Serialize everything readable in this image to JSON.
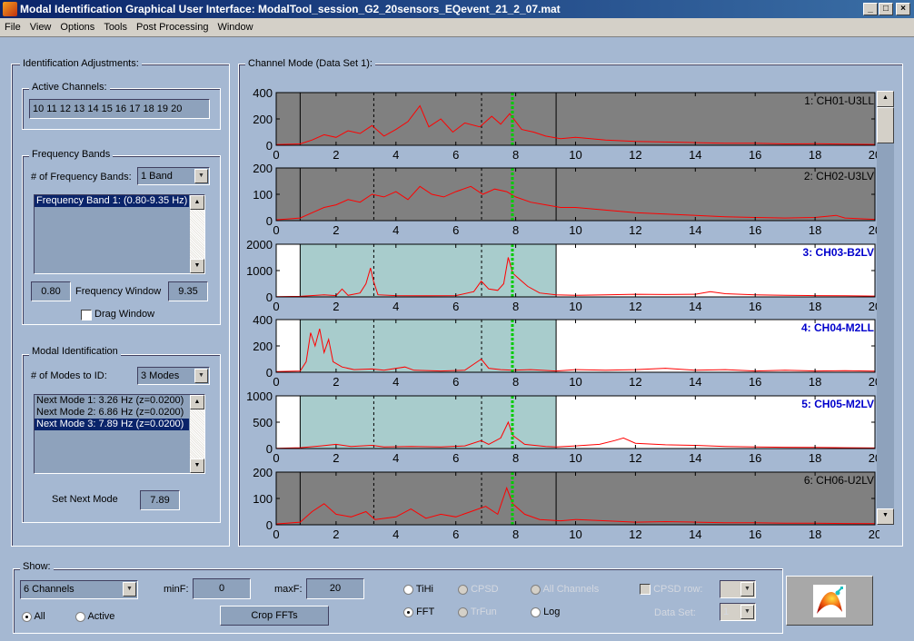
{
  "window": {
    "title": "Modal Identification Graphical User Interface: ModalTool_session_G2_20sensors_EQevent_21_2_07.mat",
    "buttons": [
      "_",
      "□",
      "×"
    ]
  },
  "menu": [
    "File",
    "View",
    "Options",
    "Tools",
    "Post Processing",
    "Window"
  ],
  "left_panel": {
    "title": "Identification Adjustments:",
    "active_channels": {
      "label": "Active Channels:",
      "value": "10 11 12 13 14 15 16 17 18 19 20"
    },
    "frequency_bands": {
      "label": "Frequency Bands",
      "count_label": "# of Frequency Bands:",
      "count_value": "1 Band",
      "items": [
        "Frequency Band 1: (0.80-9.35 Hz)"
      ],
      "selected": 0,
      "min": "0.80",
      "window_label": "Frequency Window",
      "max": "9.35",
      "drag_label": "Drag Window",
      "drag_checked": false
    },
    "modal_identification": {
      "label": "Modal Identification",
      "modes_label": "# of Modes to ID:",
      "modes_value": "3 Modes",
      "items": [
        "Next Mode 1: 3.26 Hz (z=0.0200)",
        "Next Mode 2: 6.86 Hz (z=0.0200)",
        "Next Mode 3: 7.89 Hz (z=0.0200)"
      ],
      "selected": 2,
      "set_label": "Set Next Mode",
      "set_value": "7.89"
    }
  },
  "channel_panel": {
    "title": "Channel Mode (Data Set 1):"
  },
  "show": {
    "label": "Show:",
    "channels_value": "6 Channels",
    "all_label": "All",
    "active_label": "Active",
    "view_all": true,
    "minF_label": "minF:",
    "minF": "0",
    "maxF_label": "maxF:",
    "maxF": "20",
    "crop_label": "Crop FFTs",
    "radios": {
      "tihi": "TiHi",
      "fft": "FFT",
      "cpsd": "CPSD",
      "trfun": "TrFun",
      "all_channels": "All Channels",
      "log": "Log"
    },
    "selected_mode": "FFT",
    "cpsd_row_label": "CPSD row:",
    "cpsd_row_value": "",
    "data_set_label": "Data Set:",
    "data_set_value": "1"
  },
  "icon_button": "surface-plot-icon",
  "chart_data": {
    "type": "line",
    "xlim": [
      0,
      20
    ],
    "xticks": [
      0,
      2,
      4,
      6,
      8,
      10,
      12,
      14,
      16,
      18,
      20
    ],
    "band": [
      0.8,
      9.35
    ],
    "mode_lines": [
      3.26,
      6.86
    ],
    "current_mode": 7.89,
    "colors": {
      "line": "#ff0000",
      "inactive_bg": "#808080",
      "active_bg": "#ffffff",
      "band": "#a8cccc",
      "current": "#00cc00",
      "active_title": "#0000cc"
    },
    "channels": [
      {
        "title": "1: CH01-U3LL",
        "active": false,
        "ylim": [
          0,
          400
        ],
        "yticks": [
          0,
          200,
          400
        ],
        "points": [
          [
            0,
            5
          ],
          [
            0.8,
            10
          ],
          [
            1.2,
            40
          ],
          [
            1.6,
            80
          ],
          [
            2,
            60
          ],
          [
            2.4,
            110
          ],
          [
            2.8,
            90
          ],
          [
            3.2,
            150
          ],
          [
            3.6,
            70
          ],
          [
            4,
            120
          ],
          [
            4.4,
            180
          ],
          [
            4.8,
            300
          ],
          [
            5.1,
            140
          ],
          [
            5.5,
            200
          ],
          [
            5.9,
            100
          ],
          [
            6.3,
            170
          ],
          [
            6.8,
            140
          ],
          [
            7.2,
            220
          ],
          [
            7.5,
            160
          ],
          [
            7.8,
            240
          ],
          [
            8.2,
            120
          ],
          [
            8.6,
            100
          ],
          [
            9,
            70
          ],
          [
            9.5,
            50
          ],
          [
            10,
            60
          ],
          [
            11,
            40
          ],
          [
            12,
            30
          ],
          [
            13,
            25
          ],
          [
            14,
            20
          ],
          [
            15,
            15
          ],
          [
            16,
            15
          ],
          [
            17,
            10
          ],
          [
            18,
            12
          ],
          [
            19,
            8
          ],
          [
            20,
            6
          ]
        ]
      },
      {
        "title": "2: CH02-U3LV",
        "active": false,
        "ylim": [
          0,
          200
        ],
        "yticks": [
          0,
          100,
          200
        ],
        "points": [
          [
            0,
            3
          ],
          [
            0.8,
            10
          ],
          [
            1.2,
            30
          ],
          [
            1.6,
            50
          ],
          [
            2,
            60
          ],
          [
            2.4,
            80
          ],
          [
            2.8,
            70
          ],
          [
            3.2,
            100
          ],
          [
            3.6,
            90
          ],
          [
            4,
            110
          ],
          [
            4.4,
            80
          ],
          [
            4.8,
            130
          ],
          [
            5.2,
            100
          ],
          [
            5.6,
            90
          ],
          [
            6,
            110
          ],
          [
            6.5,
            130
          ],
          [
            6.9,
            100
          ],
          [
            7.3,
            120
          ],
          [
            7.7,
            110
          ],
          [
            8,
            90
          ],
          [
            8.5,
            70
          ],
          [
            9,
            60
          ],
          [
            9.5,
            50
          ],
          [
            10,
            50
          ],
          [
            11,
            40
          ],
          [
            12,
            30
          ],
          [
            13,
            25
          ],
          [
            14,
            20
          ],
          [
            15,
            15
          ],
          [
            16,
            12
          ],
          [
            17,
            10
          ],
          [
            18,
            12
          ],
          [
            18.7,
            20
          ],
          [
            19,
            10
          ],
          [
            20,
            5
          ]
        ]
      },
      {
        "title": "3: CH03-B2LV",
        "active": true,
        "ylim": [
          0,
          2000
        ],
        "yticks": [
          0,
          1000,
          2000
        ],
        "points": [
          [
            0,
            10
          ],
          [
            0.8,
            20
          ],
          [
            1.6,
            80
          ],
          [
            2,
            50
          ],
          [
            2.2,
            300
          ],
          [
            2.4,
            60
          ],
          [
            2.8,
            150
          ],
          [
            3.0,
            500
          ],
          [
            3.15,
            1100
          ],
          [
            3.25,
            600
          ],
          [
            3.4,
            80
          ],
          [
            4,
            50
          ],
          [
            5,
            40
          ],
          [
            6,
            50
          ],
          [
            6.6,
            200
          ],
          [
            6.85,
            600
          ],
          [
            7.1,
            300
          ],
          [
            7.4,
            250
          ],
          [
            7.6,
            500
          ],
          [
            7.75,
            1500
          ],
          [
            7.9,
            900
          ],
          [
            8.1,
            700
          ],
          [
            8.4,
            400
          ],
          [
            8.8,
            150
          ],
          [
            9.35,
            80
          ],
          [
            10,
            60
          ],
          [
            11,
            80
          ],
          [
            12,
            100
          ],
          [
            13,
            90
          ],
          [
            14,
            100
          ],
          [
            14.5,
            200
          ],
          [
            15,
            120
          ],
          [
            16,
            80
          ],
          [
            17,
            60
          ],
          [
            18,
            50
          ],
          [
            19,
            40
          ],
          [
            20,
            30
          ]
        ]
      },
      {
        "title": "4: CH04-M2LL",
        "active": true,
        "ylim": [
          0,
          400
        ],
        "yticks": [
          0,
          200,
          400
        ],
        "points": [
          [
            0,
            5
          ],
          [
            0.8,
            10
          ],
          [
            1,
            80
          ],
          [
            1.15,
            300
          ],
          [
            1.3,
            200
          ],
          [
            1.45,
            330
          ],
          [
            1.6,
            150
          ],
          [
            1.75,
            250
          ],
          [
            1.9,
            80
          ],
          [
            2.2,
            40
          ],
          [
            2.6,
            20
          ],
          [
            3.2,
            25
          ],
          [
            3.6,
            15
          ],
          [
            4.3,
            40
          ],
          [
            4.6,
            15
          ],
          [
            5.5,
            10
          ],
          [
            6.3,
            15
          ],
          [
            6.85,
            100
          ],
          [
            7.1,
            30
          ],
          [
            7.5,
            20
          ],
          [
            7.9,
            15
          ],
          [
            8.5,
            20
          ],
          [
            9.35,
            10
          ],
          [
            10,
            20
          ],
          [
            11,
            15
          ],
          [
            12,
            20
          ],
          [
            13,
            30
          ],
          [
            14,
            15
          ],
          [
            15,
            20
          ],
          [
            16,
            10
          ],
          [
            17,
            15
          ],
          [
            18,
            10
          ],
          [
            19,
            12
          ],
          [
            20,
            8
          ]
        ]
      },
      {
        "title": "5: CH05-M2LV",
        "active": true,
        "ylim": [
          0,
          1000
        ],
        "yticks": [
          0,
          500,
          1000
        ],
        "points": [
          [
            0,
            5
          ],
          [
            0.8,
            15
          ],
          [
            1.5,
            50
          ],
          [
            2,
            80
          ],
          [
            2.5,
            40
          ],
          [
            3.2,
            60
          ],
          [
            3.6,
            30
          ],
          [
            4.5,
            40
          ],
          [
            5.5,
            30
          ],
          [
            6.3,
            50
          ],
          [
            6.85,
            150
          ],
          [
            7.1,
            80
          ],
          [
            7.5,
            200
          ],
          [
            7.75,
            500
          ],
          [
            7.9,
            250
          ],
          [
            8.3,
            80
          ],
          [
            9,
            40
          ],
          [
            9.35,
            30
          ],
          [
            10,
            50
          ],
          [
            10.8,
            80
          ],
          [
            11.3,
            150
          ],
          [
            11.6,
            200
          ],
          [
            12,
            100
          ],
          [
            13,
            70
          ],
          [
            14,
            60
          ],
          [
            15,
            40
          ],
          [
            16,
            30
          ],
          [
            17,
            25
          ],
          [
            18,
            20
          ],
          [
            19,
            15
          ],
          [
            20,
            10
          ]
        ]
      },
      {
        "title": "6: CH06-U2LV",
        "active": false,
        "ylim": [
          0,
          200
        ],
        "yticks": [
          0,
          100,
          200
        ],
        "points": [
          [
            0,
            3
          ],
          [
            0.8,
            10
          ],
          [
            1.2,
            50
          ],
          [
            1.6,
            80
          ],
          [
            2,
            40
          ],
          [
            2.5,
            30
          ],
          [
            3,
            50
          ],
          [
            3.3,
            20
          ],
          [
            4,
            30
          ],
          [
            4.5,
            60
          ],
          [
            5,
            25
          ],
          [
            5.5,
            40
          ],
          [
            6,
            30
          ],
          [
            6.5,
            50
          ],
          [
            7,
            70
          ],
          [
            7.4,
            40
          ],
          [
            7.7,
            140
          ],
          [
            7.9,
            80
          ],
          [
            8.3,
            40
          ],
          [
            8.8,
            20
          ],
          [
            9.5,
            15
          ],
          [
            10,
            20
          ],
          [
            11,
            15
          ],
          [
            12,
            10
          ],
          [
            13,
            12
          ],
          [
            14,
            10
          ],
          [
            15,
            8
          ],
          [
            16,
            8
          ],
          [
            17,
            6
          ],
          [
            18,
            6
          ],
          [
            19,
            5
          ],
          [
            20,
            4
          ]
        ]
      }
    ]
  }
}
